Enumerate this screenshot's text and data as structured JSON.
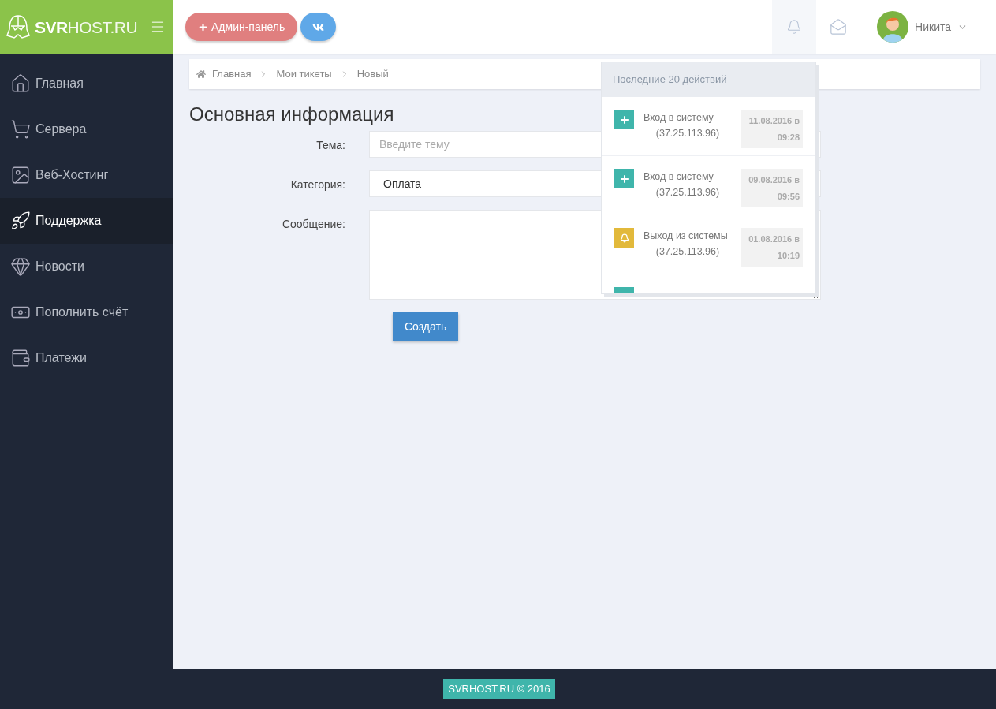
{
  "logo": {
    "primary": "SVR",
    "secondary": "HOST.RU"
  },
  "header": {
    "buttons": [
      {
        "kind": "admin",
        "label": "Админ-панель"
      },
      {
        "kind": "vk"
      }
    ],
    "user": {
      "name": "Никита"
    }
  },
  "sidebar": {
    "items": [
      {
        "label": "Главная",
        "selected": false
      },
      {
        "label": "Сервера",
        "selected": false
      },
      {
        "label": "Веб-Хостинг",
        "selected": false
      },
      {
        "label": "Поддержка",
        "selected": true
      },
      {
        "label": "Новости",
        "selected": false
      },
      {
        "label": "Пополнить счёт",
        "selected": false
      },
      {
        "label": "Платежи",
        "selected": false
      }
    ]
  },
  "breadcrumb": [
    "Главная",
    "Мои тикеты",
    "Новый"
  ],
  "form": {
    "title": "Основная информация",
    "fields": [
      {
        "kind": "input",
        "label": "Тема:",
        "placeholder": "Введите тему"
      },
      {
        "kind": "select",
        "label": "Категория:",
        "value": "Оплата"
      },
      {
        "kind": "textarea",
        "label": "Сообщение:"
      }
    ],
    "submit": "Создать"
  },
  "notifications": {
    "title": "Последние 20 действий",
    "items": [
      {
        "kind": "login",
        "text": "Вход в систему",
        "ip": "(37.25.113.96)",
        "date": "11.08.2016 в",
        "time": "09:28"
      },
      {
        "kind": "login",
        "text": "Вход в систему",
        "ip": "(37.25.113.96)",
        "date": "09.08.2016 в",
        "time": "09:56"
      },
      {
        "kind": "logout",
        "text": "Выход из системы",
        "ip": "(37.25.113.96)",
        "date": "01.08.2016 в",
        "time": "10:19"
      },
      {
        "kind": "login"
      }
    ]
  },
  "footer": {
    "text": "SVRHOST.RU © 2016"
  }
}
